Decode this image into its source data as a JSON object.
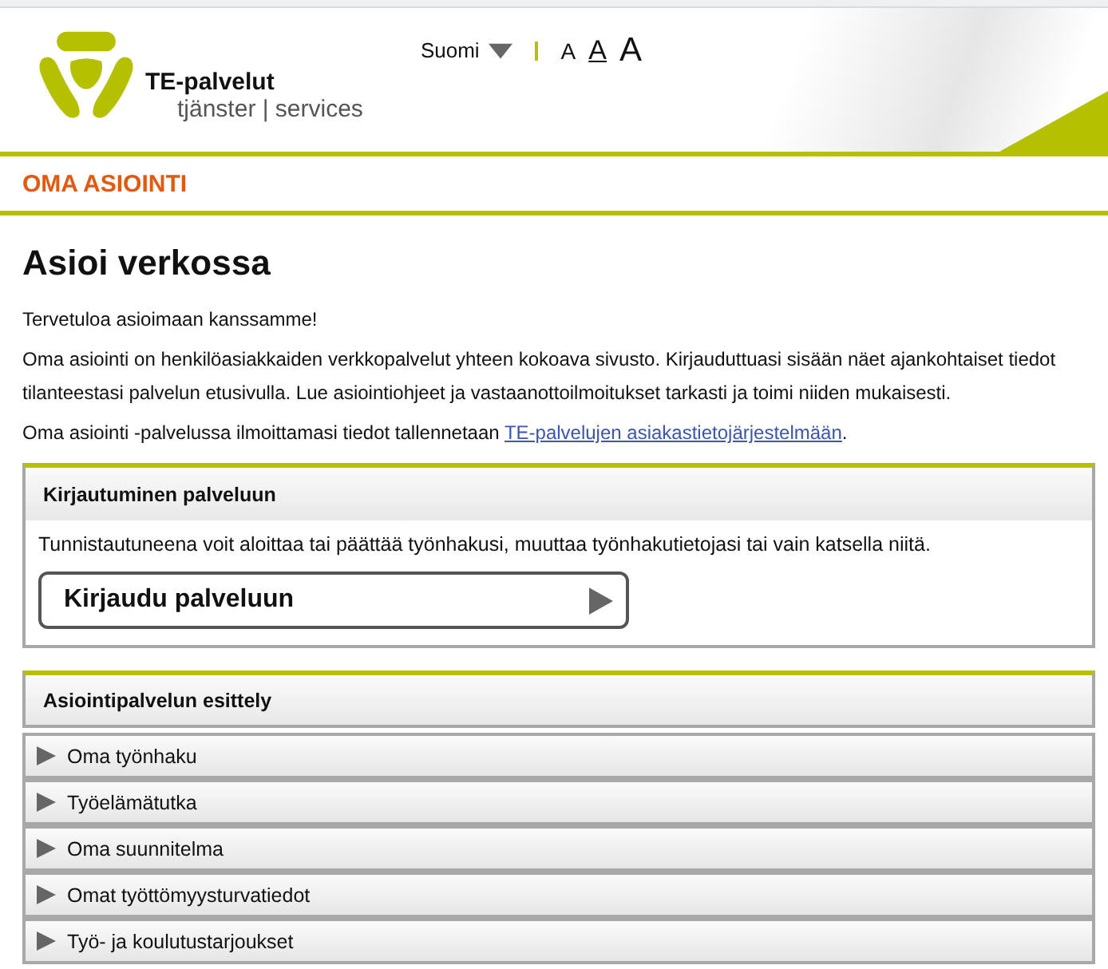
{
  "logo": {
    "name": "TE-palvelut",
    "subtitle": "tjänster | services"
  },
  "language": {
    "label": "Suomi"
  },
  "text_sizes": [
    {
      "label": "A",
      "selected": false
    },
    {
      "label": "A",
      "selected": true
    },
    {
      "label": "A",
      "selected": false
    }
  ],
  "section_bar": {
    "title": "OMA ASIOINTI"
  },
  "heading": "Asioi verkossa",
  "intro": [
    "Tervetuloa asioimaan kanssamme!",
    "Oma asiointi on henkilöasiakkaiden verkkopalvelut yhteen kokoava sivusto. Kirjauduttuasi sisään näet ajankohtaiset tiedot tilanteestasi palvelun etusivulla. Lue asiointiohjeet ja vastaanottoilmoitukset tarkasti ja toimi niiden mukaisesti."
  ],
  "storage_note": {
    "text": "Oma asiointi -palvelussa ilmoittamasi tiedot tallennetaan",
    "link": "TE-palvelujen asiakastietojärjestelmään",
    "suffix": "."
  },
  "login_panel": {
    "title": "Kirjautuminen palveluun",
    "description": "Tunnistautuneena voit aloittaa tai päättää työnhakusi, muuttaa työnhakutietojasi tai vain katsella niitä.",
    "button": "Kirjaudu palveluun"
  },
  "intro_panel": {
    "title": "Asiointipalvelun esittely",
    "items": [
      {
        "label": "Oma työnhaku",
        "expanded": false
      },
      {
        "label": "Työelämätutka",
        "expanded": false
      },
      {
        "label": "Oma suunnitelma",
        "expanded": false
      },
      {
        "label": "Omat työttömyysturvatiedot",
        "expanded": false
      },
      {
        "label": "Työ- ja koulutustarjoukset",
        "expanded": false
      }
    ]
  }
}
